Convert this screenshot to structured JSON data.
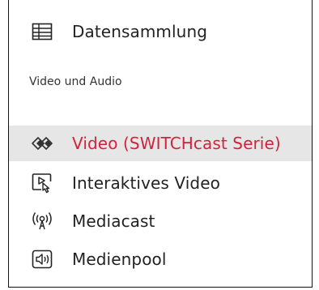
{
  "menu": {
    "items_top": [
      {
        "label": "Datensammlung",
        "icon": "table-icon"
      }
    ],
    "section_header": "Video und Audio",
    "items": [
      {
        "label": "Video (SWITCHcast Serie)",
        "icon": "switchcast-icon",
        "selected": true
      },
      {
        "label": "Interaktives Video",
        "icon": "interactive-video-icon",
        "selected": false
      },
      {
        "label": "Mediacast",
        "icon": "broadcast-icon",
        "selected": false
      },
      {
        "label": "Medienpool",
        "icon": "speaker-icon",
        "selected": false
      }
    ]
  },
  "colors": {
    "selected_text": "#d0243a",
    "selected_background": "#e6e6e6",
    "text": "#222222",
    "border": "#111111"
  }
}
